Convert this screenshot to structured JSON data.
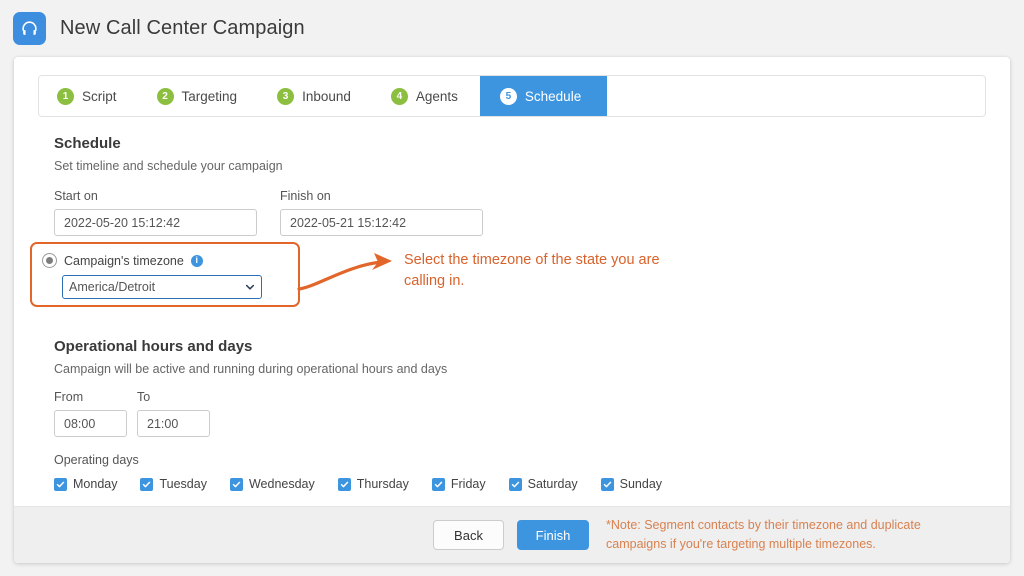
{
  "header": {
    "title": "New Call Center Campaign",
    "icon": "headset-icon"
  },
  "tabs": [
    {
      "number": "1",
      "label": "Script",
      "active": false
    },
    {
      "number": "2",
      "label": "Targeting",
      "active": false
    },
    {
      "number": "3",
      "label": "Inbound",
      "active": false
    },
    {
      "number": "4",
      "label": "Agents",
      "active": false
    },
    {
      "number": "5",
      "label": "Schedule",
      "active": true
    }
  ],
  "schedule": {
    "title": "Schedule",
    "subtitle": "Set timeline and schedule your campaign",
    "start_label": "Start on",
    "start_value": "2022-05-20 15:12:42",
    "finish_label": "Finish on",
    "finish_value": "2022-05-21 15:12:42"
  },
  "timezone": {
    "radio_label": "Campaign's timezone",
    "info_icon": "info-icon",
    "selected": "America/Detroit",
    "chevron": "chevron-down-icon"
  },
  "annotation": {
    "text": "Select the timezone of the state you are calling in.",
    "color": "#d9622b",
    "arrow": "curved-arrow-icon"
  },
  "operational": {
    "title": "Operational hours and days",
    "subtitle": "Campaign will be active and running during operational hours and days",
    "from_label": "From",
    "from_value": "08:00",
    "to_label": "To",
    "to_value": "21:00",
    "days_label": "Operating days",
    "days": [
      {
        "label": "Monday",
        "checked": true
      },
      {
        "label": "Tuesday",
        "checked": true
      },
      {
        "label": "Wednesday",
        "checked": true
      },
      {
        "label": "Thursday",
        "checked": true
      },
      {
        "label": "Friday",
        "checked": true
      },
      {
        "label": "Saturday",
        "checked": true
      },
      {
        "label": "Sunday",
        "checked": true
      }
    ]
  },
  "footer": {
    "back_label": "Back",
    "finish_label": "Finish",
    "note": "*Note: Segment contacts by their timezone and duplicate campaigns if you're targeting multiple timezones.",
    "note_color": "#d9814f"
  },
  "colors": {
    "accent_blue": "#3d95e0",
    "badge_green": "#8cbf3f",
    "highlight_orange": "#e2662a",
    "page_background": "#f2f2f2"
  }
}
